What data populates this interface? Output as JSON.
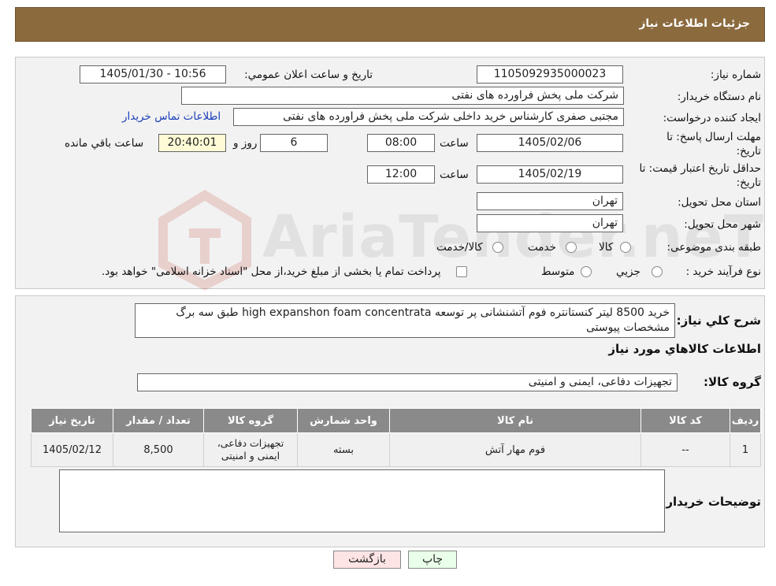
{
  "header": {
    "title": "جزئيات اطلاعات نياز"
  },
  "watermark": {
    "text": "AriaTender.neT"
  },
  "info": {
    "need_number_label": "شماره نياز:",
    "need_number": "1105092935000023",
    "announce_label": "تاريخ و ساعت اعلان عمومي:",
    "announce_value": "1405/01/30 - 10:56",
    "buyer_label": "نام دستگاه خريدار:",
    "buyer_value": "شرکت ملی پخش فراورده های نفتی",
    "creator_label": "ايجاد کننده درخواست:",
    "creator_value": "مجتبی صفری کارشناس خرید داخلی شرکت ملی پخش فراورده های نفتی",
    "contact_link": "اطلاعات تماس خريدار",
    "deadline_label_1": "مهلت ارسال پاسخ: تا",
    "deadline_label_2": "تاريخ:",
    "deadline_date": "1405/02/06",
    "time_word": "ساعت",
    "deadline_time": "08:00",
    "days_value": "6",
    "days_word": "روز و",
    "remaining_time": "20:40:01",
    "remaining_word": "ساعت باقي مانده",
    "validity_label_1": "حداقل تاريخ اعتبار قيمت: تا",
    "validity_label_2": "تاريخ:",
    "validity_date": "1405/02/19",
    "validity_time": "12:00",
    "province_label": "استان محل تحويل:",
    "province_value": "تهران",
    "city_label": "شهر محل تحويل:",
    "city_value": "تهران",
    "category_label": "طبقه بندی موضوعی:",
    "category_options": [
      "کالا",
      "خدمت",
      "کالا/خدمت"
    ],
    "process_label": "نوع فرآيند خريد :",
    "process_options": [
      "جزيي",
      "متوسط"
    ],
    "process_note": "پرداخت تمام يا بخشی از مبلغ خريد،از محل \"اسناد خزانه اسلامی\" خواهد بود."
  },
  "details": {
    "summary_label": "شرح کلي نياز:",
    "summary_text": "خرید 8500 لیتر کنستانتره فوم آتشنشانی پر توسعه high expanshon foam concentrata طبق سه برگ مشخصات پیوستی",
    "goods_info_title": "اطلاعات کالاهاي مورد نياز",
    "goods_group_label": "گروه کالا:",
    "goods_group_value": "تجهیزات دفاعی، ایمنی و امنیتی",
    "table": {
      "headers": [
        "رديف",
        "کد کالا",
        "نام کالا",
        "واحد شمارش",
        "گروه کالا",
        "تعداد / مقدار",
        "تاريخ نياز"
      ],
      "rows": [
        [
          "1",
          "--",
          "فوم مهار آتش",
          "بسته",
          "تجهیزات دفاعی، ایمنی و امنیتی",
          "8,500",
          "1405/02/12"
        ]
      ]
    },
    "buyer_notes_label": "توضيحات خريدار:",
    "buyer_notes_value": ""
  },
  "buttons": {
    "print": "چاپ",
    "back": "بازگشت"
  },
  "colors": {
    "header_bg": "#8b6a3e",
    "table_header_bg": "#8a8a8a",
    "link": "#1a3fb8",
    "print_bg": "#eaffea",
    "back_bg": "#ffe4e4",
    "remaining_bg": "#fffbd6"
  }
}
